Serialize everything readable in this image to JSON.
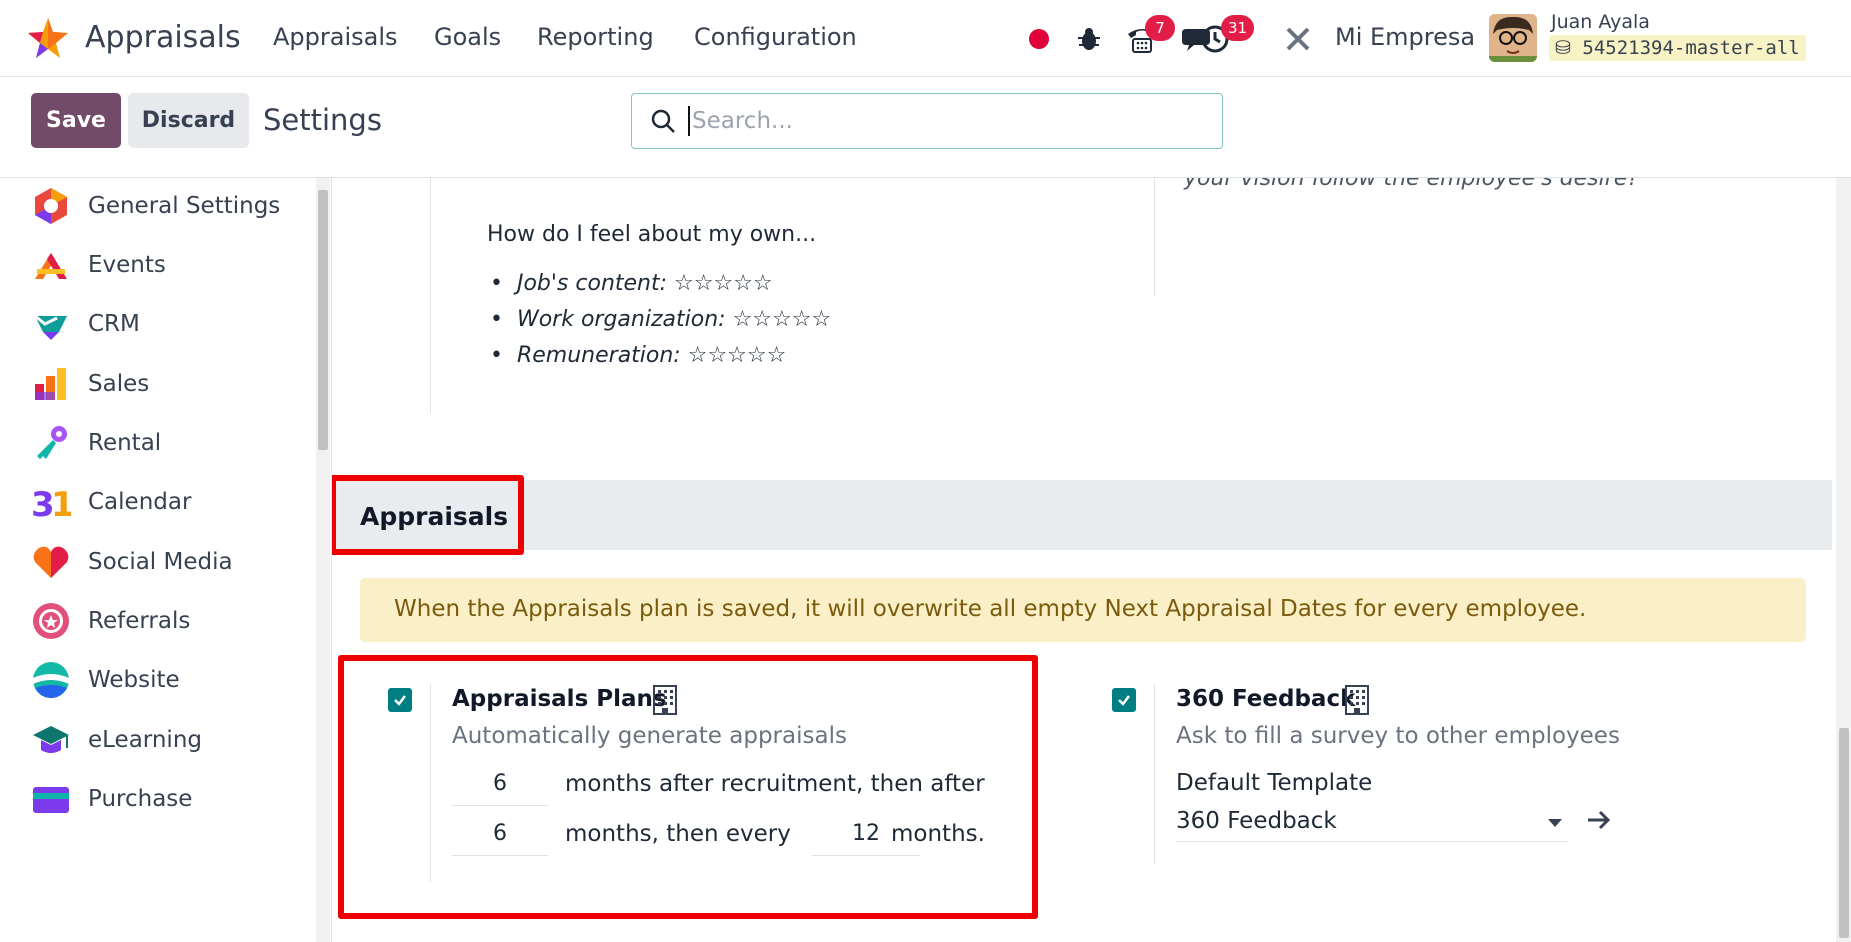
{
  "navbar": {
    "app_name": "Appraisals",
    "menus": [
      "Appraisals",
      "Goals",
      "Reporting",
      "Configuration"
    ],
    "chat_badge": "7",
    "activity_badge": "31",
    "company": "Mi Empresa",
    "user_name": "Juan Ayala",
    "db_name": "54521394-master-all"
  },
  "controls": {
    "save_label": "Save",
    "discard_label": "Discard",
    "title": "Settings",
    "search_placeholder": "Search..."
  },
  "sidebar": {
    "items": [
      {
        "label": "General Settings",
        "icon": "general-settings-icon"
      },
      {
        "label": "Events",
        "icon": "events-icon"
      },
      {
        "label": "CRM",
        "icon": "crm-icon"
      },
      {
        "label": "Sales",
        "icon": "sales-icon"
      },
      {
        "label": "Rental",
        "icon": "rental-icon"
      },
      {
        "label": "Calendar",
        "icon": "calendar-icon"
      },
      {
        "label": "Social Media",
        "icon": "social-media-icon"
      },
      {
        "label": "Referrals",
        "icon": "referrals-icon"
      },
      {
        "label": "Website",
        "icon": "website-icon"
      },
      {
        "label": "eLearning",
        "icon": "elearning-icon"
      },
      {
        "label": "Purchase",
        "icon": "purchase-icon"
      }
    ]
  },
  "template_preview": {
    "cut_text": "your vision follow the employee's desire?",
    "question": "How do I feel about my own...",
    "items": [
      {
        "label": "Job's content:",
        "stars": "☆☆☆☆☆"
      },
      {
        "label": "Work organization:",
        "stars": "☆☆☆☆☆"
      },
      {
        "label": "Remuneration:",
        "stars": "☆☆☆☆☆"
      }
    ]
  },
  "appraisals_section": {
    "title": "Appraisals",
    "alert": "When the Appraisals plan is saved, it will overwrite all empty Next Appraisal Dates for every employee.",
    "plans": {
      "title": "Appraisals Plans",
      "description": "Automatically generate appraisals",
      "checked": true,
      "first_months": "6",
      "text_1": "months after recruitment, then after",
      "second_months": "6",
      "text_2": "months, then every",
      "every_months": "12",
      "text_3": "months."
    },
    "feedback": {
      "title": "360 Feedback",
      "description": "Ask to fill a survey to other employees",
      "checked": true,
      "template_label": "Default Template",
      "template_value": "360 Feedback"
    }
  },
  "colors": {
    "primary": "#714b67",
    "checkbox": "#017e84",
    "highlight": "#ef0000",
    "alert_bg": "#fbefc8"
  }
}
